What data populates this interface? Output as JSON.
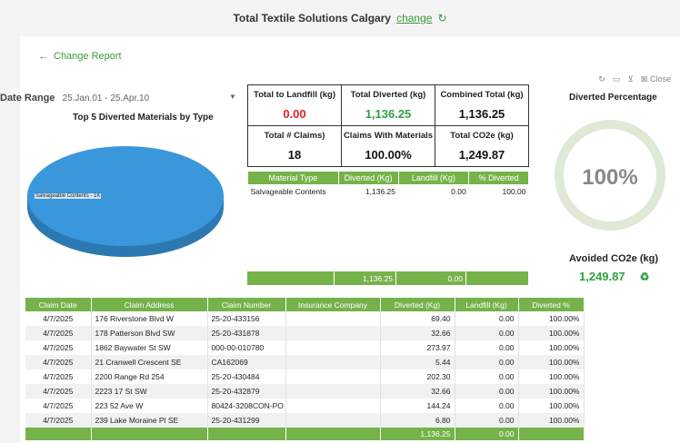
{
  "header": {
    "company": "Total Textile Solutions Calgary",
    "change_link": "change",
    "refresh_icon": "refresh-icon"
  },
  "nav": {
    "change_report": "Change Report",
    "back_icon": "arrow-left-icon"
  },
  "toolbar": {
    "close_label": "Close",
    "icons": [
      "refresh-icon",
      "export-icon",
      "filter-icon",
      "close-icon"
    ]
  },
  "date_range": {
    "label": "Date Range",
    "value": "25.Jan.01 - 25.Apr.10"
  },
  "pie": {
    "title": "Top 5 Diverted Materials by Type",
    "slice_label": "Salvageable Contents - 1K"
  },
  "kpis": [
    {
      "label": "Total to Landfill (kg)",
      "value": "0.00",
      "color": "#e02020"
    },
    {
      "label": "Total Diverted (kg)",
      "value": "1,136.25",
      "color": "#2ea043"
    },
    {
      "label": "Combined Total (kg)",
      "value": "1,136.25",
      "color": "#111111"
    },
    {
      "label": "Total # Claims)",
      "value": "18",
      "color": "#111111"
    },
    {
      "label": "Claims With Materials",
      "value": "100.00%",
      "color": "#111111"
    },
    {
      "label": "Total CO2e (kg)",
      "value": "1,249.87",
      "color": "#111111"
    }
  ],
  "materials": {
    "headers": [
      "Material Type",
      "Diverted (Kg)",
      "Landfill (Kg)",
      "% Diverted"
    ],
    "rows": [
      {
        "type": "Salvageable Contents",
        "diverted": "1,136.25",
        "landfill": "0.00",
        "pct": "100.00"
      }
    ],
    "footer": {
      "diverted": "1,136.25",
      "landfill": "0.00"
    }
  },
  "diverted_percentage": {
    "title": "Diverted Percentage",
    "value": "100%",
    "fraction": 1.0
  },
  "avoided": {
    "title": "Avoided CO2e (kg)",
    "value": "1,249.87",
    "icon": "recycle-icon"
  },
  "claims": {
    "headers": [
      "Claim Date",
      "Claim Address",
      "Claim Number",
      "Insurance Company",
      "Diverted (Kg)",
      "Landfill (Kg)",
      "Diverted %"
    ],
    "rows": [
      {
        "date": "4/7/2025",
        "address": "176 Riverstone Blvd W",
        "number": "25-20-433156",
        "insurer": "",
        "diverted": "69.40",
        "landfill": "0.00",
        "pct": "100.00%"
      },
      {
        "date": "4/7/2025",
        "address": "178 Patterson Blvd SW",
        "number": "25-20-431878",
        "insurer": "",
        "diverted": "32.66",
        "landfill": "0.00",
        "pct": "100.00%"
      },
      {
        "date": "4/7/2025",
        "address": "1862 Baywater St SW",
        "number": "000-00-010780",
        "insurer": "",
        "diverted": "273.97",
        "landfill": "0.00",
        "pct": "100.00%"
      },
      {
        "date": "4/7/2025",
        "address": "21 Cranwell Crescent SE",
        "number": "CA162069",
        "insurer": "",
        "diverted": "5.44",
        "landfill": "0.00",
        "pct": "100.00%"
      },
      {
        "date": "4/7/2025",
        "address": "2200 Range Rd 254",
        "number": "25-20-430484",
        "insurer": "",
        "diverted": "202.30",
        "landfill": "0.00",
        "pct": "100.00%"
      },
      {
        "date": "4/7/2025",
        "address": "2223 17 St SW",
        "number": "25-20-432879",
        "insurer": "",
        "diverted": "32.66",
        "landfill": "0.00",
        "pct": "100.00%"
      },
      {
        "date": "4/7/2025",
        "address": "223 52 Ave W",
        "number": "80424-3208CON-PO",
        "insurer": "",
        "diverted": "144.24",
        "landfill": "0.00",
        "pct": "100.00%"
      },
      {
        "date": "4/7/2025",
        "address": "239 Lake Moraine Pl SE",
        "number": "25-20-431299",
        "insurer": "",
        "diverted": "6.80",
        "landfill": "0.00",
        "pct": "100.00%"
      }
    ],
    "footer": {
      "diverted": "1,136.25",
      "landfill": "0.00"
    }
  },
  "colors": {
    "accent": "#76b24a",
    "link": "#3a9a3a",
    "pie": "#3a97db",
    "ring": "#dfe9d6"
  }
}
